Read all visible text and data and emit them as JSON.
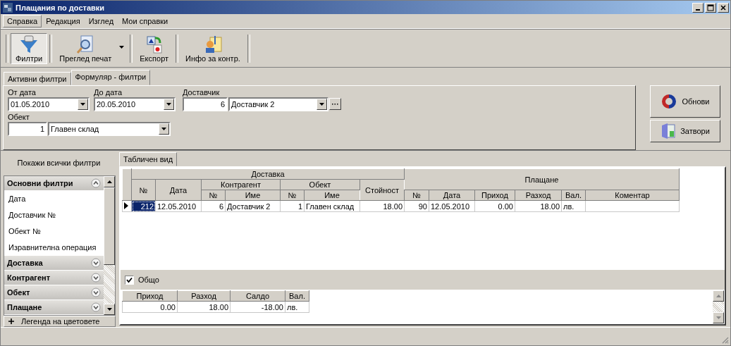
{
  "window": {
    "title": "Плащания по доставки"
  },
  "menu": [
    {
      "label": "Справка",
      "selected": true
    },
    {
      "label": "Редакция",
      "selected": false
    },
    {
      "label": "Изглед",
      "selected": false
    },
    {
      "label": "Мои справки",
      "selected": false
    }
  ],
  "toolbar": [
    {
      "label": "Филтри",
      "kind": "filters",
      "pressed": true,
      "dropdown": false
    },
    {
      "label": "Преглед печат",
      "kind": "preview",
      "pressed": false,
      "dropdown": true
    },
    {
      "label": "Експорт",
      "kind": "export",
      "pressed": false,
      "dropdown": false
    },
    {
      "label": "Инфо за контр.",
      "kind": "info",
      "pressed": false,
      "dropdown": false
    }
  ],
  "filter_tabs": [
    {
      "label": "Активни филтри",
      "selected": false
    },
    {
      "label": "Формуляр - филтри",
      "selected": true
    }
  ],
  "filters": {
    "from_date": {
      "label": "От дата",
      "value": "01.05.2010"
    },
    "to_date": {
      "label": "До дата",
      "value": "20.05.2010"
    },
    "supplier": {
      "label": "Доставчик",
      "code": "6",
      "value": "Доставчик 2"
    },
    "object": {
      "label": "Обект",
      "code": "1",
      "value": "Главен склад"
    }
  },
  "actions": [
    {
      "label": "Обнови",
      "kind": "refresh"
    },
    {
      "label": "Затвори",
      "kind": "close"
    }
  ],
  "sidebar": {
    "show_all": "Покажи всички филтри",
    "groups": [
      {
        "label": "Основни филтри",
        "expanded": true,
        "children": [
          {
            "label": "Дата"
          },
          {
            "label": "Доставчик №"
          },
          {
            "label": "Обект №"
          },
          {
            "label": "Изравнителна операция"
          }
        ]
      },
      {
        "label": "Доставка",
        "expanded": false
      },
      {
        "label": "Контрагент",
        "expanded": false
      },
      {
        "label": "Обект",
        "expanded": false
      },
      {
        "label": "Плащане",
        "expanded": false
      }
    ],
    "legend": "Легенда на цветовете"
  },
  "grid": {
    "tab": {
      "label": "Табличен вид",
      "selected": true
    },
    "header": [
      {
        "label": "Доставка",
        "children": [
          {
            "label": "№",
            "kind": "number"
          },
          {
            "label": "Дата",
            "kind": "text"
          },
          {
            "label": "Контрагент",
            "children": [
              {
                "label": "№",
                "kind": "number"
              },
              {
                "label": "Име",
                "kind": "text"
              }
            ]
          },
          {
            "label": "Обект",
            "children": [
              {
                "label": "№",
                "kind": "number"
              },
              {
                "label": "Име",
                "kind": "text"
              }
            ]
          },
          {
            "label": "Стойност",
            "kind": "number"
          }
        ]
      },
      {
        "label": "Плащане",
        "children": [
          {
            "label": "№",
            "kind": "number"
          },
          {
            "label": "Дата",
            "kind": "text"
          },
          {
            "label": "Приход",
            "kind": "number"
          },
          {
            "label": "Разход",
            "kind": "number"
          },
          {
            "label": "Вал.",
            "kind": "text"
          },
          {
            "label": "Коментар",
            "kind": "text"
          }
        ]
      }
    ],
    "rows": [
      {
        "current": true,
        "cells": [
          "212",
          "12.05.2010",
          "6",
          "Доставчик 2",
          "1",
          "Главен склад",
          "18.00",
          "90",
          "12.05.2010",
          "0.00",
          "18.00",
          "лв."
        ]
      }
    ]
  },
  "totals": {
    "label": "Общо",
    "checked": true,
    "columns": [
      {
        "label": "Приход",
        "kind": "number"
      },
      {
        "label": "Разход",
        "kind": "number"
      },
      {
        "label": "Салдо",
        "kind": "number"
      },
      {
        "label": "Вал.",
        "kind": "text"
      }
    ],
    "rows": [
      [
        "0.00",
        "18.00",
        "-18.00",
        "лв."
      ]
    ]
  }
}
